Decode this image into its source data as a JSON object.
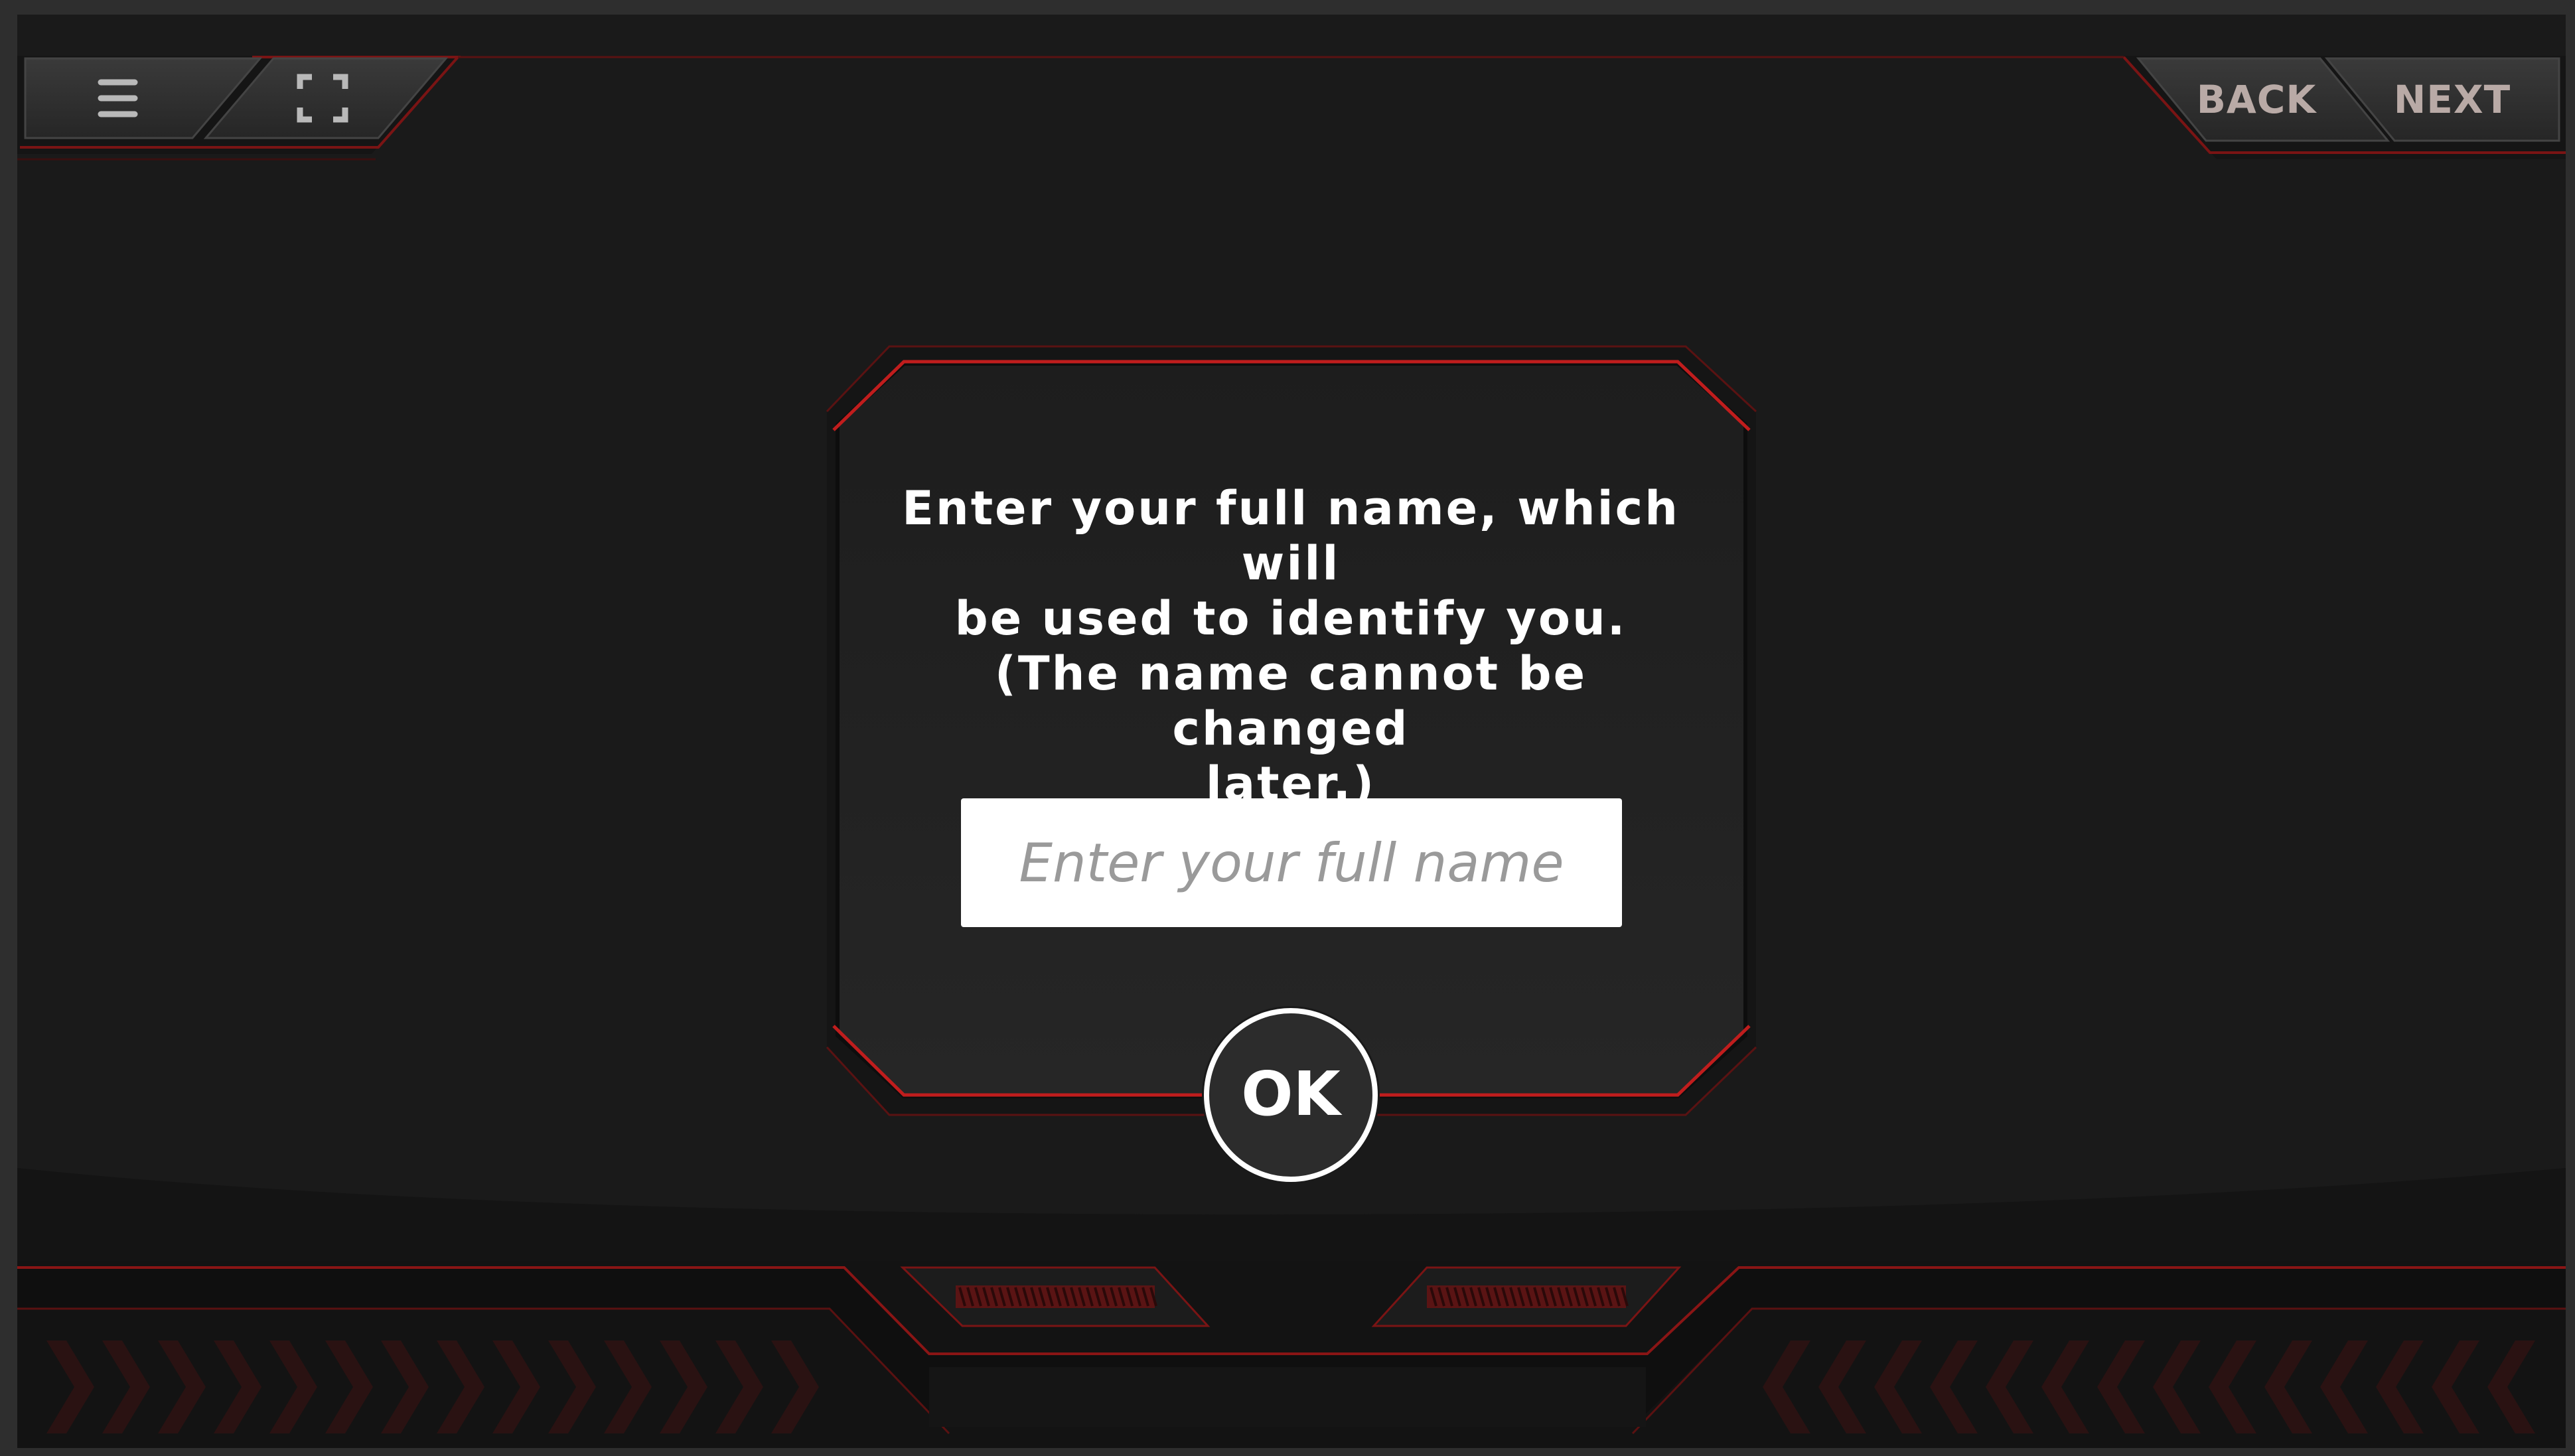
{
  "toolbar": {
    "menu_icon": "hamburger-menu-icon",
    "fullscreen_icon": "fullscreen-icon",
    "back_label": "BACK",
    "next_label": "NEXT"
  },
  "dialog": {
    "prompt_line_1": "Enter your full name, which will",
    "prompt_line_2": "be used to identify you.",
    "prompt_line_3": "(The name cannot be changed",
    "prompt_line_4": "later.)",
    "name_placeholder": "Enter your full name",
    "name_value": "",
    "ok_label": "OK"
  },
  "colors": {
    "background": "#1a1a1a",
    "frame": "#2e2e2e",
    "accent_red": "#c01d1d",
    "panel": "#222222",
    "text": "#ffffff",
    "nav_text": "#b9aaa6"
  }
}
